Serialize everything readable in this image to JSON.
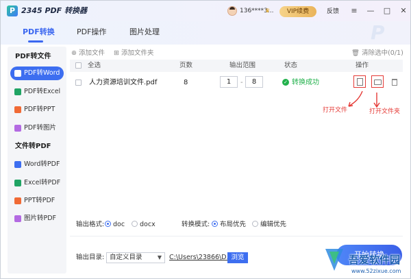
{
  "app": {
    "title": "2345 PDF 转换器",
    "logo_letter": "P",
    "user": "136****3...",
    "vip_button": "VIP续费",
    "feedback": "反馈",
    "window_controls": [
      "≡",
      "—",
      "□",
      "✕"
    ]
  },
  "tabs": [
    {
      "label": "PDF转换",
      "active": true
    },
    {
      "label": "PDF操作",
      "active": false
    },
    {
      "label": "图片处理",
      "active": false
    }
  ],
  "sidebar": {
    "group1": "PDF转文件",
    "group1_items": [
      {
        "label": "PDF转Word",
        "active": true,
        "icon": "word-icon",
        "color": "#3d6ef0"
      },
      {
        "label": "PDF转Excel",
        "active": false,
        "icon": "excel-icon",
        "color": "#20a464"
      },
      {
        "label": "PDF转PPT",
        "active": false,
        "icon": "ppt-icon",
        "color": "#f06a35"
      },
      {
        "label": "PDF转图片",
        "active": false,
        "icon": "image-icon",
        "color": "#b36ae2"
      }
    ],
    "group2": "文件转PDF",
    "group2_items": [
      {
        "label": "Word转PDF",
        "icon": "word-icon",
        "color": "#3d6ef0"
      },
      {
        "label": "Excel转PDF",
        "icon": "excel-icon",
        "color": "#20a464"
      },
      {
        "label": "PPT转PDF",
        "icon": "ppt-icon",
        "color": "#f06a35"
      },
      {
        "label": "图片转PDF",
        "icon": "image-icon",
        "color": "#b36ae2"
      }
    ]
  },
  "toolbar": {
    "add_file": "添加文件",
    "add_folder": "添加文件夹",
    "clear_selected": "清除选中(0/1)"
  },
  "table": {
    "headers": {
      "select_all": "全选",
      "pages": "页数",
      "range": "输出范围",
      "status": "状态",
      "actions": "操作"
    },
    "rows": [
      {
        "name": "人力资源培训文件.pdf",
        "pages": "8",
        "range_from": "1",
        "range_to": "8",
        "range_sep": "-",
        "status": "转换成功"
      }
    ]
  },
  "annotations": {
    "open_file": "打开文件",
    "open_folder": "打开文件夹"
  },
  "options": {
    "format_label": "输出格式:",
    "format_doc": "doc",
    "format_docx": "docx",
    "mode_label": "转换模式:",
    "mode_layout": "布局优先",
    "mode_edit": "编辑优先"
  },
  "output": {
    "dir_label": "输出目录:",
    "dir_select": "自定义目录",
    "path": "C:\\Users\\23866\\D...",
    "browse": "浏览",
    "convert": "开始转换"
  },
  "watermark": {
    "text": "吾爱软件园",
    "url": "www.52zixue.com"
  },
  "colors": {
    "accent": "#3d6ef0",
    "success": "#22b14c",
    "annotation": "#e53935",
    "vip": "#eab45a"
  }
}
